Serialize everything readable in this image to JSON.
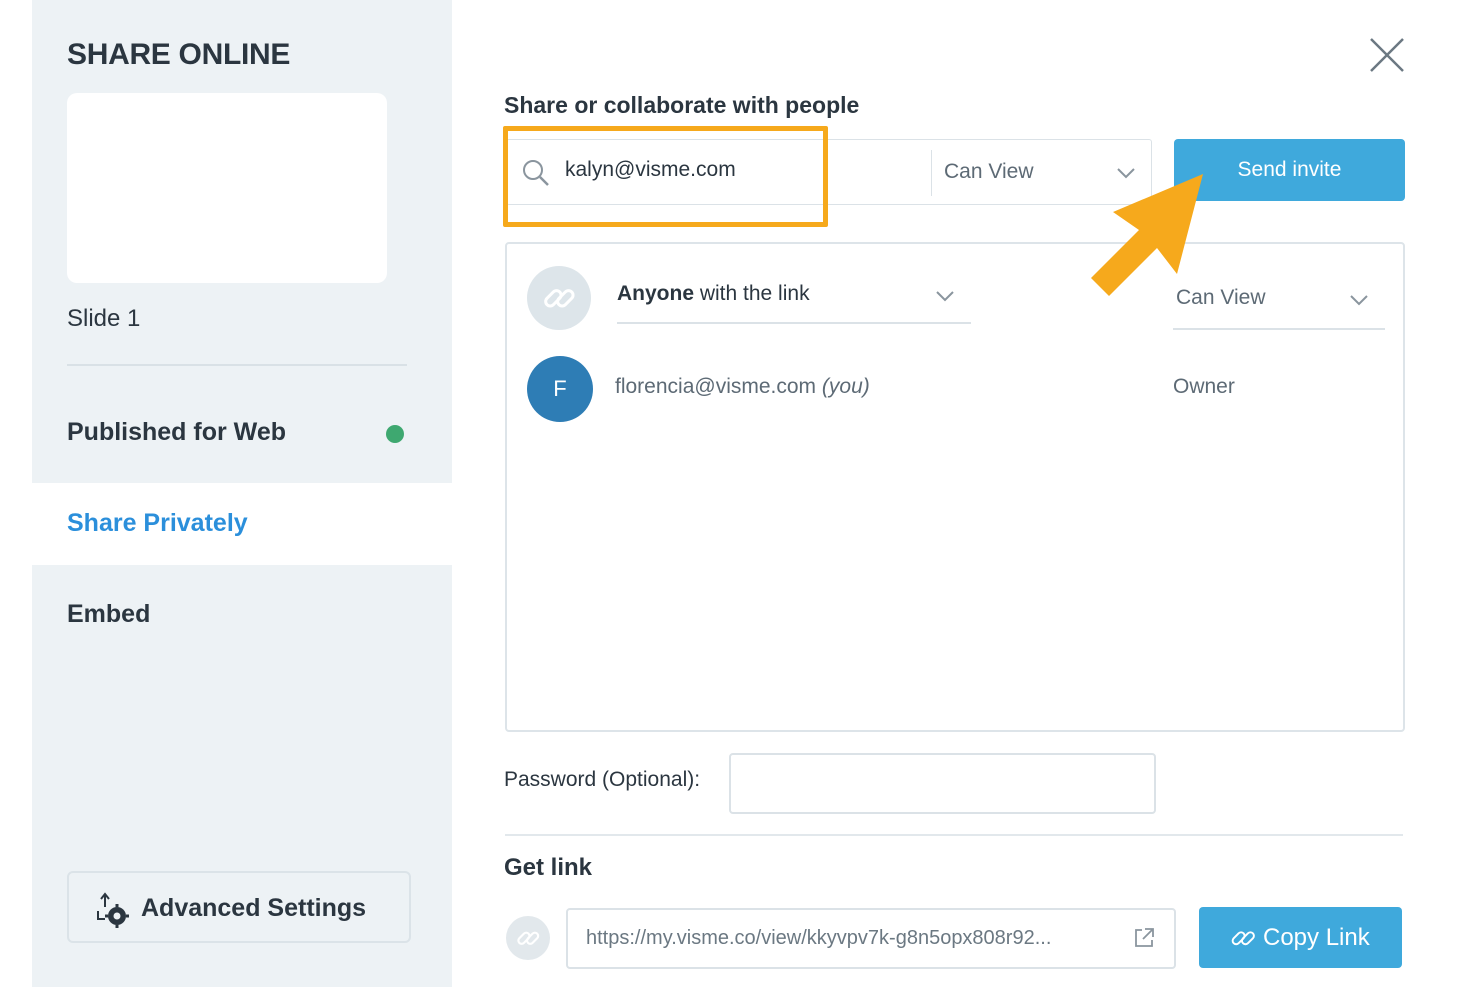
{
  "sidebar": {
    "title": "SHARE ONLINE",
    "slide_label": "Slide 1",
    "nav": {
      "published": "Published for Web",
      "share_privately": "Share Privately",
      "embed": "Embed"
    },
    "published_status_color": "#3ea870",
    "advanced_settings": "Advanced Settings"
  },
  "main": {
    "section_title": "Share or collaborate with people",
    "invite": {
      "value": "kalyn@visme.com",
      "permission": "Can View",
      "send_label": "Send invite"
    },
    "people": {
      "link_access_bold": "Anyone",
      "link_access_rest": " with the link",
      "link_permission": "Can View",
      "owner": {
        "initial": "F",
        "email": "florencia@visme.com",
        "you_tag": "(you)",
        "role": "Owner"
      }
    },
    "password_label": "Password (Optional):",
    "get_link": {
      "title": "Get link",
      "url": "https://my.visme.co/view/kkyvpv7k-g8n5opx808r92...",
      "copy_label": "Copy Link"
    }
  },
  "colors": {
    "accent": "#3fa9dc",
    "active_nav": "#2b8fdb",
    "highlight": "#f6a91c",
    "avatar": "#2e7db5"
  }
}
